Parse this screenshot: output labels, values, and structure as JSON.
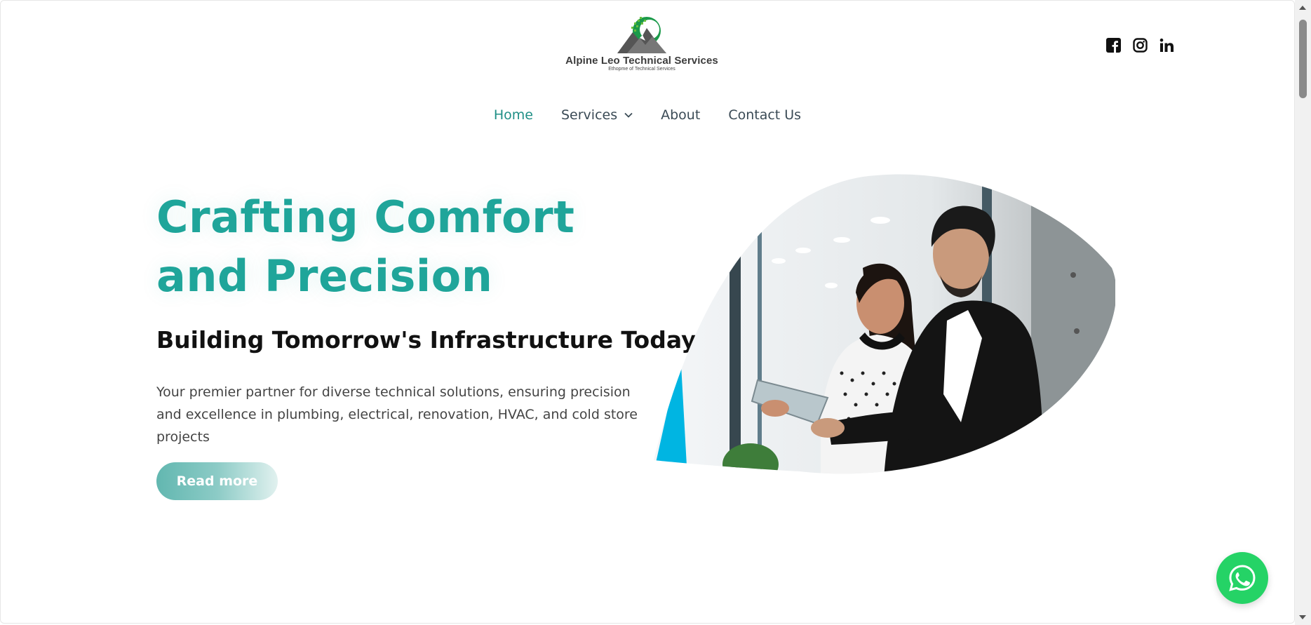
{
  "brand": {
    "name": "Alpine Leo Technical Services",
    "tagline": "Ethopme of Technical Services"
  },
  "social": [
    {
      "icon": "facebook-icon"
    },
    {
      "icon": "instagram-icon"
    },
    {
      "icon": "linkedin-icon"
    }
  ],
  "nav": {
    "items": [
      {
        "label": "Home",
        "active": true
      },
      {
        "label": "Services",
        "has_dropdown": true
      },
      {
        "label": "About"
      },
      {
        "label": "Contact Us"
      }
    ]
  },
  "hero": {
    "title": "Crafting Comfort and Precision",
    "subtitle": "Building Tomorrow's Infrastructure Today",
    "description": "Your premier partner for diverse technical solutions, ensuring precision and excellence in plumbing, electrical, renovation, HVAC, and cold store projects",
    "cta_label": "Read more"
  },
  "colors": {
    "accent": "#1fa59a",
    "nav_active": "#1f8f86",
    "whatsapp": "#25d366",
    "image_accent": "#00b5e2"
  },
  "floating": {
    "icon": "whatsapp-icon"
  }
}
